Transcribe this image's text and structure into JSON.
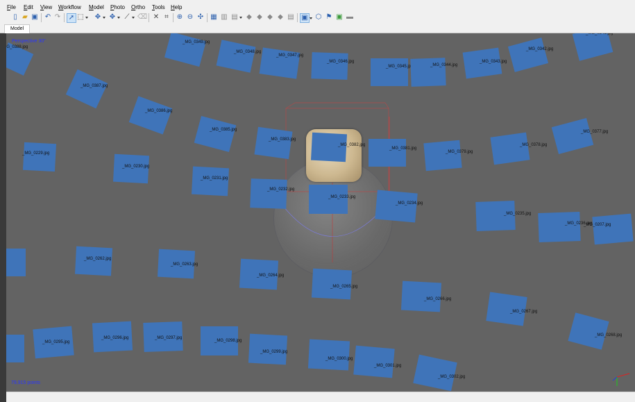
{
  "menu": [
    "File",
    "Edit",
    "View",
    "Workflow",
    "Model",
    "Photo",
    "Ortho",
    "Tools",
    "Help"
  ],
  "tab": "Model",
  "viewport": {
    "mode_label": "Perspective 30°",
    "points_label": "79,915 points"
  },
  "colors": {
    "camera": "#3f74b9",
    "background": "#636363",
    "overlay_text": "#2a35ff"
  },
  "toolbar_icons": [
    "new-icon",
    "open-icon",
    "save-icon",
    "undo-icon",
    "redo-icon",
    "navigation-icon",
    "rect-select-icon",
    "move-object-icon",
    "move-region-icon",
    "move-ruler-icon",
    "eraser-icon",
    "delete-icon",
    "crop-icon",
    "zoom-in-icon",
    "zoom-out-icon",
    "reset-view-icon",
    "show-cameras-icon",
    "grid-icon",
    "show-aligned-icon",
    "point-cloud-icon",
    "dense-cloud-icon",
    "mesh-icon",
    "texture-icon",
    "tiled-icon",
    "region-icon",
    "shapes-icon",
    "markers-icon",
    "display-icon",
    "print-icon"
  ],
  "cameras": [
    {
      "label": "_MG_0388.jpg"
    },
    {
      "label": "_MG_0349.jpg"
    },
    {
      "label": "_MG_0348.jpg"
    },
    {
      "label": "_MG_0347.jpg"
    },
    {
      "label": "_MG_0346.jpg"
    },
    {
      "label": "_MG_0345.jpg"
    },
    {
      "label": "_MG_0344.jpg"
    },
    {
      "label": "_MG_0343.jpg"
    },
    {
      "label": "_MG_0342.jpg"
    },
    {
      "label": "_MG_0341.jpg"
    },
    {
      "label": "_MG_0387.jpg"
    },
    {
      "label": "_MG_0386.jpg"
    },
    {
      "label": "_MG_0385.jpg"
    },
    {
      "label": "_MG_0383.jpg"
    },
    {
      "label": "_MG_0382.jpg"
    },
    {
      "label": "_MG_0381.jpg"
    },
    {
      "label": "_MG_0379.jpg"
    },
    {
      "label": "_MG_0378.jpg"
    },
    {
      "label": "_MG_0377.jpg"
    },
    {
      "label": "_MG_0229.jpg"
    },
    {
      "label": "_MG_0230.jpg"
    },
    {
      "label": "_MG_0231.jpg"
    },
    {
      "label": "_MG_0232.jpg"
    },
    {
      "label": "_MG_0233.jpg"
    },
    {
      "label": "_MG_0234.jpg"
    },
    {
      "label": "_MG_0235.jpg"
    },
    {
      "label": "_MG_0236.jpg"
    },
    {
      "label": "_MG_0207.jpg"
    },
    {
      "label": "_MG_0262.jpg"
    },
    {
      "label": "_MG_0263.jpg"
    },
    {
      "label": "_MG_0264.jpg"
    },
    {
      "label": "_MG_0265.jpg"
    },
    {
      "label": "_MG_0266.jpg"
    },
    {
      "label": "_MG_0267.jpg"
    },
    {
      "label": "_MG_0268.jpg"
    },
    {
      "label": "_MG_0295.jpg"
    },
    {
      "label": "_MG_0296.jpg"
    },
    {
      "label": "_MG_0297.jpg"
    },
    {
      "label": "_MG_0298.jpg"
    },
    {
      "label": "_MG_0299.jpg"
    },
    {
      "label": "_MG_0300.jpg"
    },
    {
      "label": "_MG_0301.jpg"
    },
    {
      "label": "_MG_0302.jpg"
    }
  ]
}
